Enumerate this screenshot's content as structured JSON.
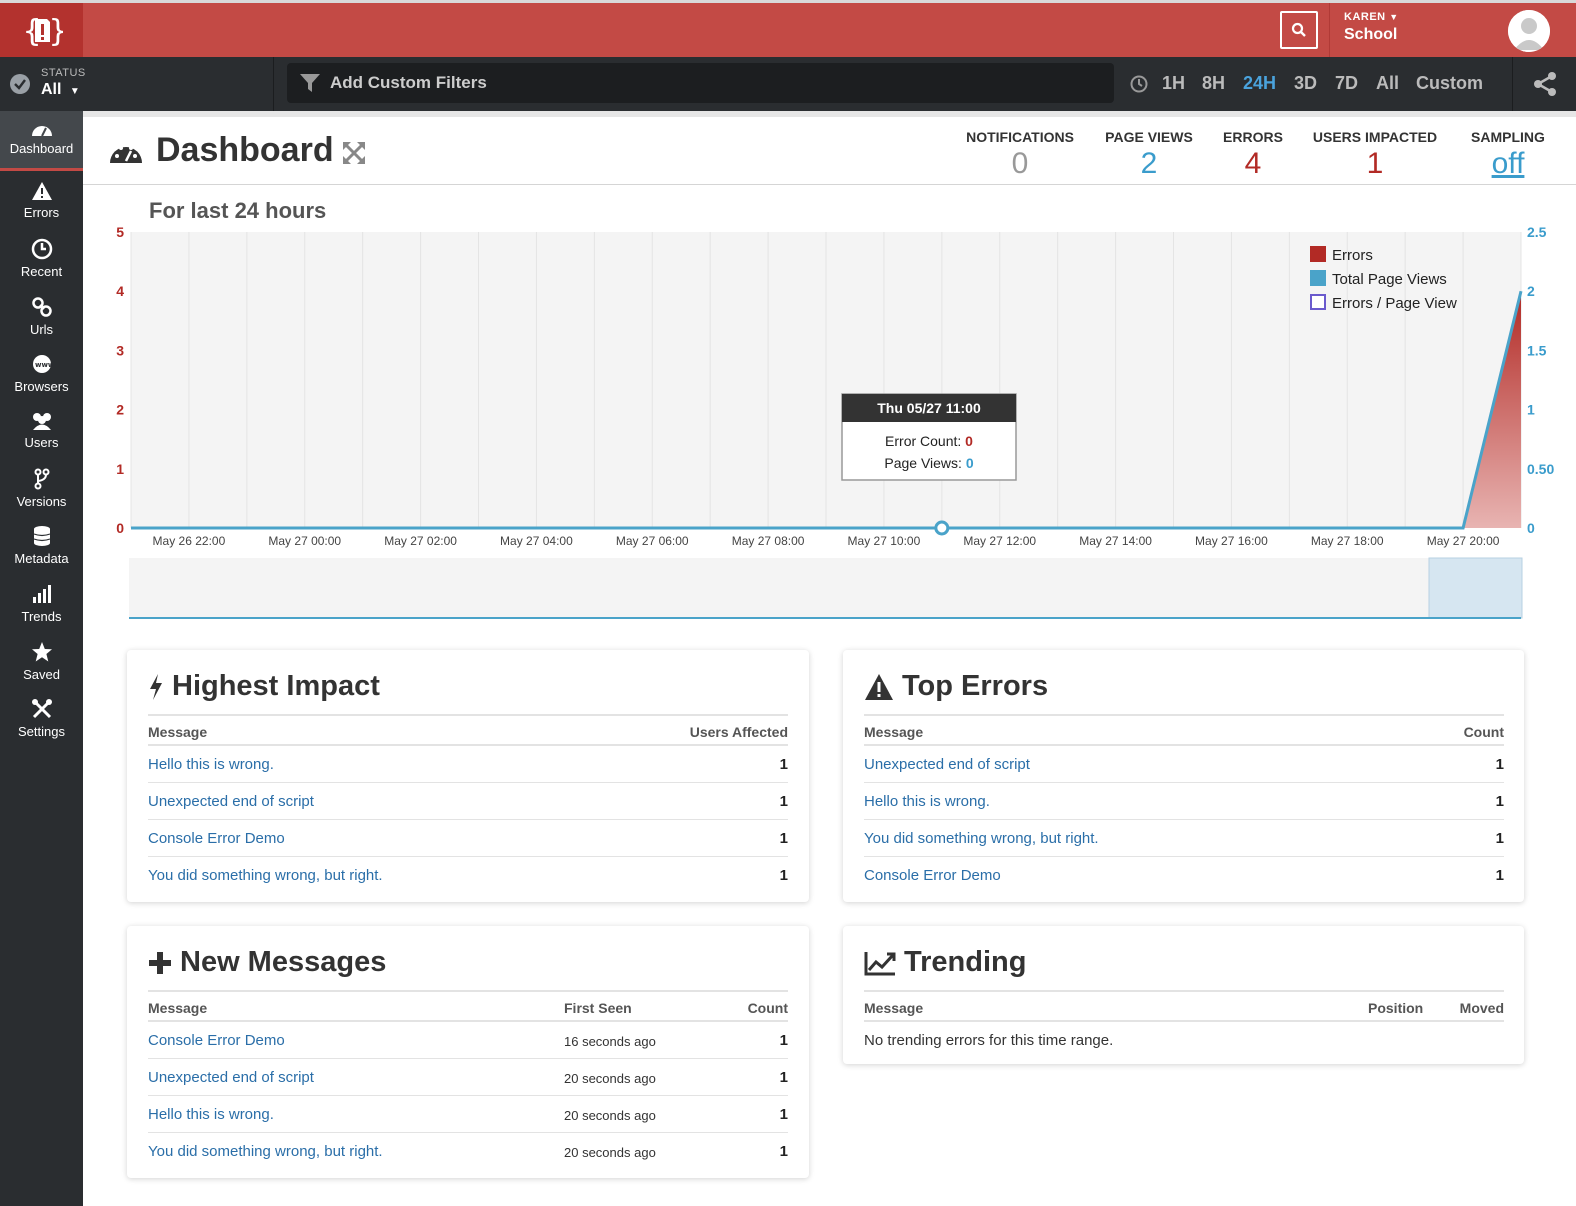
{
  "header": {
    "user": {
      "name": "KAREN",
      "org": "School"
    }
  },
  "toolbar": {
    "status_label": "STATUS",
    "status_value": "All",
    "filter_placeholder": "Add Custom Filters",
    "ranges": [
      "1H",
      "8H",
      "24H",
      "3D",
      "7D",
      "All",
      "Custom"
    ],
    "active_range": "24H"
  },
  "sidebar": {
    "items": [
      {
        "label": "Dashboard",
        "icon": "dashboard-icon"
      },
      {
        "label": "Errors",
        "icon": "warning-icon"
      },
      {
        "label": "Recent",
        "icon": "clock-icon"
      },
      {
        "label": "Urls",
        "icon": "link-icon"
      },
      {
        "label": "Browsers",
        "icon": "globe-icon"
      },
      {
        "label": "Users",
        "icon": "users-icon"
      },
      {
        "label": "Versions",
        "icon": "branch-icon"
      },
      {
        "label": "Metadata",
        "icon": "database-icon"
      },
      {
        "label": "Trends",
        "icon": "bar-chart-icon"
      },
      {
        "label": "Saved",
        "icon": "star-icon"
      },
      {
        "label": "Settings",
        "icon": "tools-icon"
      }
    ]
  },
  "page": {
    "title": "Dashboard",
    "stats": [
      {
        "label": "NOTIFICATIONS",
        "value": "0",
        "color": "#999999"
      },
      {
        "label": "PAGE VIEWS",
        "value": "2",
        "color": "#3a9ccc"
      },
      {
        "label": "ERRORS",
        "value": "4",
        "color": "#b22a25"
      },
      {
        "label": "USERS IMPACTED",
        "value": "1",
        "color": "#b22a25"
      },
      {
        "label": "SAMPLING",
        "value": "off",
        "color": "#3a9ccc"
      }
    ],
    "range_title": "For last 24 hours"
  },
  "chart_data": {
    "type": "area",
    "x": [
      "May 26 22:00",
      "May 27 00:00",
      "May 27 02:00",
      "May 27 04:00",
      "May 27 06:00",
      "May 27 08:00",
      "May 27 10:00",
      "May 27 12:00",
      "May 27 14:00",
      "May 27 16:00",
      "May 27 18:00",
      "May 27 20:00",
      "May 27 21:00"
    ],
    "x_tick_labels": [
      "May 26 22:00",
      "May 27 00:00",
      "May 27 02:00",
      "May 27 04:00",
      "May 27 06:00",
      "May 27 08:00",
      "May 27 10:00",
      "May 27 12:00",
      "May 27 14:00",
      "May 27 16:00",
      "May 27 18:00",
      "May 27 20:00"
    ],
    "series": [
      {
        "name": "Errors",
        "values": [
          0,
          0,
          0,
          0,
          0,
          0,
          0,
          0,
          0,
          0,
          0,
          0,
          4
        ],
        "color": "#b22a25",
        "axis": "left"
      },
      {
        "name": "Total Page Views",
        "values": [
          0,
          0,
          0,
          0,
          0,
          0,
          0,
          0,
          0,
          0,
          0,
          0,
          2
        ],
        "color": "#4aa3c9",
        "axis": "right"
      },
      {
        "name": "Errors / Page View",
        "values": [],
        "color": "#6a5acd",
        "axis": "right"
      }
    ],
    "y_left": {
      "ticks": [
        "0",
        "1",
        "2",
        "3",
        "4",
        "5"
      ],
      "ylim": [
        0,
        5
      ],
      "color": "#b22a25"
    },
    "y_right": {
      "ticks": [
        "0",
        "0.50",
        "1",
        "1.5",
        "2",
        "2.5"
      ],
      "ylim": [
        0,
        2.5
      ],
      "color": "#3a9ccc"
    },
    "legend": "top-right",
    "grid": true,
    "tooltip": {
      "title": "Thu 05/27 11:00",
      "error_label": "Error Count:",
      "error_value": "0",
      "pv_label": "Page Views:",
      "pv_value": "0"
    }
  },
  "panels": {
    "highest_impact": {
      "title": "Highest Impact",
      "columns": [
        "Message",
        "Users Affected"
      ],
      "rows": [
        {
          "message": "Hello this is wrong.",
          "value": "1"
        },
        {
          "message": "Unexpected end of script",
          "value": "1"
        },
        {
          "message": "Console Error Demo",
          "value": "1"
        },
        {
          "message": "You did something wrong, but right.",
          "value": "1"
        }
      ]
    },
    "top_errors": {
      "title": "Top Errors",
      "columns": [
        "Message",
        "Count"
      ],
      "rows": [
        {
          "message": "Unexpected end of script",
          "value": "1"
        },
        {
          "message": "Hello this is wrong.",
          "value": "1"
        },
        {
          "message": "You did something wrong, but right.",
          "value": "1"
        },
        {
          "message": "Console Error Demo",
          "value": "1"
        }
      ]
    },
    "new_messages": {
      "title": "New Messages",
      "columns": [
        "Message",
        "First Seen",
        "Count"
      ],
      "rows": [
        {
          "message": "Console Error Demo",
          "first_seen": "16 seconds ago",
          "value": "1"
        },
        {
          "message": "Unexpected end of script",
          "first_seen": "20 seconds ago",
          "value": "1"
        },
        {
          "message": "Hello this is wrong.",
          "first_seen": "20 seconds ago",
          "value": "1"
        },
        {
          "message": "You did something wrong, but right.",
          "first_seen": "20 seconds ago",
          "value": "1"
        }
      ]
    },
    "trending": {
      "title": "Trending",
      "columns": [
        "Message",
        "Position",
        "Moved"
      ],
      "empty": "No trending errors for this time range."
    }
  }
}
